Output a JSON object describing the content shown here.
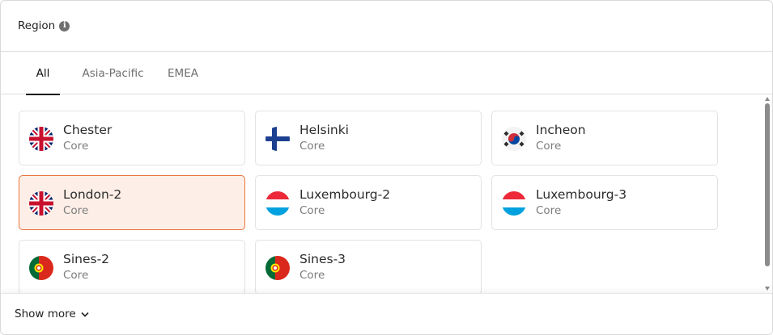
{
  "header": {
    "title": "Region",
    "info_icon": "info-icon"
  },
  "tabs": [
    {
      "label": "All",
      "active": true
    },
    {
      "label": "Asia-Pacific",
      "active": false
    },
    {
      "label": "EMEA",
      "active": false
    }
  ],
  "regions": [
    {
      "name": "Chester",
      "tier": "Core",
      "flag": "uk-flag-icon",
      "selected": false
    },
    {
      "name": "Helsinki",
      "tier": "Core",
      "flag": "finland-flag-icon",
      "selected": false
    },
    {
      "name": "Incheon",
      "tier": "Core",
      "flag": "south-korea-flag-icon",
      "selected": false
    },
    {
      "name": "London-2",
      "tier": "Core",
      "flag": "uk-flag-icon",
      "selected": true
    },
    {
      "name": "Luxembourg-2",
      "tier": "Core",
      "flag": "luxembourg-flag-icon",
      "selected": false
    },
    {
      "name": "Luxembourg-3",
      "tier": "Core",
      "flag": "luxembourg-flag-icon",
      "selected": false
    },
    {
      "name": "Sines-2",
      "tier": "Core",
      "flag": "portugal-flag-icon",
      "selected": false
    },
    {
      "name": "Sines-3",
      "tier": "Core",
      "flag": "portugal-flag-icon",
      "selected": false
    }
  ],
  "footer": {
    "show_more_label": "Show more",
    "icon": "chevron-down-icon"
  },
  "colors": {
    "selected_bg": "#fdefe7",
    "selected_border": "#e8743c"
  }
}
